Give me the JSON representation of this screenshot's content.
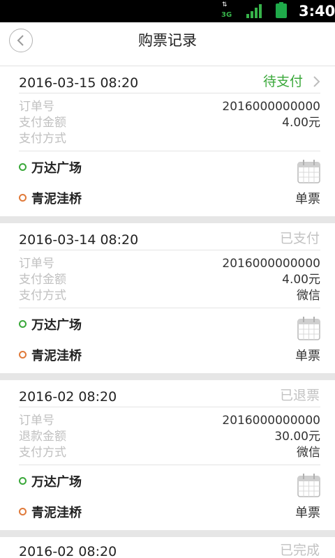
{
  "status_bar": {
    "network": "3G",
    "time": "3:40",
    "signal_color": "#37b34a",
    "battery_color": "#1faa4a"
  },
  "header": {
    "title": "购票记录",
    "back_icon": "chevron-left-icon"
  },
  "colors": {
    "pending": "#3aa83a",
    "muted_status": "#c2c2c2",
    "from_dot": "#3aa83a",
    "to_dot": "#e07a3a"
  },
  "orders": [
    {
      "date": "2016-03-15  08:20",
      "status": "待支付",
      "rows": [
        {
          "label": "订单号",
          "value": "2016000000000"
        },
        {
          "label": "支付金额",
          "value": "4.00元"
        },
        {
          "label": "支付方式",
          "value": ""
        }
      ],
      "from": "万达广场",
      "to": "青泥洼桥",
      "ticket_type": "单票"
    },
    {
      "date": "2016-03-14  08:20",
      "status": "已支付",
      "rows": [
        {
          "label": "订单号",
          "value": "2016000000000"
        },
        {
          "label": "支付金额",
          "value": "4.00元"
        },
        {
          "label": "支付方式",
          "value": "微信"
        }
      ],
      "from": "万达广场",
      "to": "青泥洼桥",
      "ticket_type": "单票"
    },
    {
      "date": "2016-02  08:20",
      "status": "已退票",
      "rows": [
        {
          "label": "订单号",
          "value": "2016000000000"
        },
        {
          "label": "退款金额",
          "value": "30.00元"
        },
        {
          "label": "支付方式",
          "value": "微信"
        }
      ],
      "from": "万达广场",
      "to": "青泥洼桥",
      "ticket_type": "单票"
    },
    {
      "date": "2016-02  08:20",
      "status": "已完成"
    }
  ]
}
